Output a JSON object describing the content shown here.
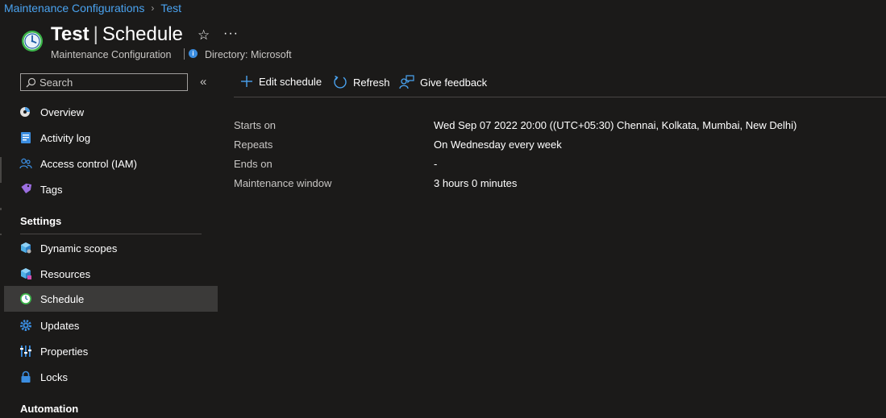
{
  "breadcrumb": {
    "items": [
      "Maintenance Configurations",
      "Test"
    ],
    "separator": "›"
  },
  "header": {
    "title_bold": "Test",
    "title_divider": "|",
    "title_rest": "Schedule",
    "subtitle": "Maintenance Configuration",
    "directory": "Directory: Microsoft",
    "more": "···",
    "star": "☆"
  },
  "search": {
    "placeholder": "Search"
  },
  "collapse": "«",
  "sidebar": {
    "items": [
      {
        "label": "Overview"
      },
      {
        "label": "Activity log"
      },
      {
        "label": "Access control (IAM)"
      },
      {
        "label": "Tags"
      }
    ],
    "settings_heading": "Settings",
    "settings_items": [
      {
        "label": "Dynamic scopes"
      },
      {
        "label": "Resources"
      },
      {
        "label": "Schedule"
      },
      {
        "label": "Updates"
      },
      {
        "label": "Properties"
      },
      {
        "label": "Locks"
      }
    ],
    "automation_heading": "Automation"
  },
  "toolbar": {
    "edit": "Edit schedule",
    "refresh": "Refresh",
    "feedback": "Give feedback"
  },
  "schedule": {
    "rows": [
      {
        "label": "Starts on",
        "value": "Wed Sep 07 2022 20:00 ((UTC+05:30) Chennai, Kolkata, Mumbai, New Delhi)"
      },
      {
        "label": "Repeats",
        "value": "On Wednesday every week"
      },
      {
        "label": "Ends on",
        "value": "-"
      },
      {
        "label": "Maintenance window",
        "value": "3 hours 0 minutes"
      }
    ]
  },
  "colors": {
    "accent": "#4aa3f0",
    "background": "#1b1a19",
    "selected": "#3b3a39"
  }
}
